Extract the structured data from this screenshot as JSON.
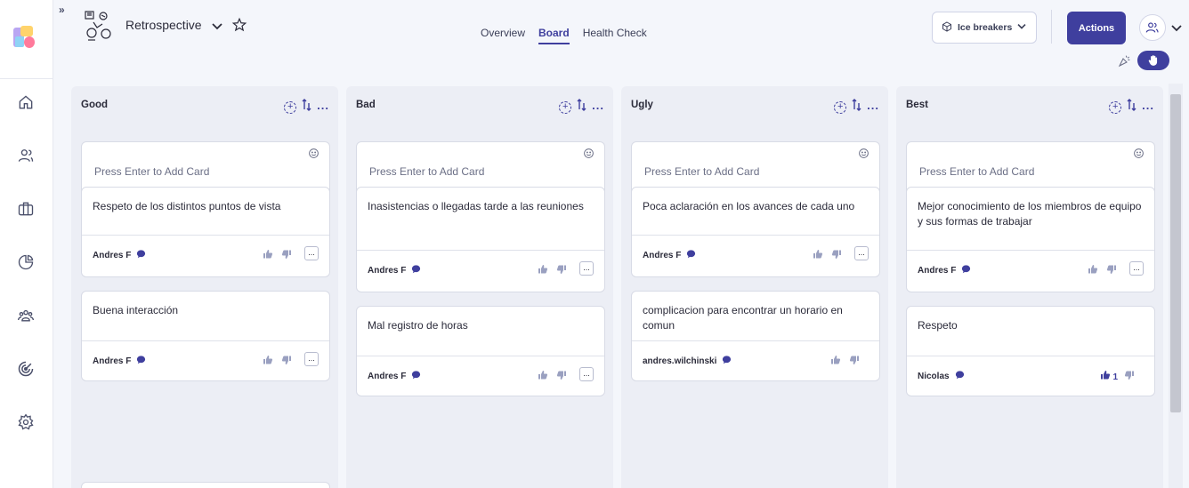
{
  "sidebar": {
    "items": [
      {
        "icon": "home-icon"
      },
      {
        "icon": "users-icon"
      },
      {
        "icon": "briefcase-icon"
      },
      {
        "icon": "pie-chart-icon"
      },
      {
        "icon": "team-icon"
      },
      {
        "icon": "target-icon"
      },
      {
        "icon": "gear-icon"
      }
    ]
  },
  "header": {
    "collapse": "»",
    "title": "Retrospective",
    "tabs": [
      "Overview",
      "Board",
      "Health Check"
    ],
    "active_tab": "Board",
    "ice_breakers": "Ice breakers",
    "actions": "Actions"
  },
  "colors": {
    "accent": "#3f3f9e",
    "board_bg": "#eceef5",
    "page_bg": "#f4f6fb"
  },
  "columns": [
    {
      "name": "Good",
      "placeholder": "Press Enter to Add Card",
      "cards": [
        {
          "text": "Respeto de los distintos puntos de vista",
          "author": "Andres F",
          "likes": ""
        },
        {
          "text": "Buena interacción",
          "author": "Andres F",
          "likes": ""
        }
      ]
    },
    {
      "name": "Bad",
      "placeholder": "Press Enter to Add Card",
      "cards": [
        {
          "text": "Inasistencias o llegadas tarde a las reuniones",
          "author": "Andres F",
          "likes": ""
        },
        {
          "text": "Mal registro de horas",
          "author": "Andres F",
          "likes": ""
        }
      ]
    },
    {
      "name": "Ugly",
      "placeholder": "Press Enter to Add Card",
      "cards": [
        {
          "text": "Poca aclaración en los avances de cada uno",
          "author": "Andres F",
          "likes": ""
        },
        {
          "text": "complicacion para encontrar un horario en comun",
          "author": "andres.wilchinski",
          "likes": ""
        }
      ]
    },
    {
      "name": "Best",
      "placeholder": "Press Enter to Add Card",
      "cards": [
        {
          "text": "Mejor conocimiento de los miembros de equipo y sus formas de trabajar",
          "author": "Andres F",
          "likes": ""
        },
        {
          "text": "Respeto",
          "author": "Nicolas",
          "likes": "1"
        }
      ]
    }
  ],
  "card_more_label": "..."
}
